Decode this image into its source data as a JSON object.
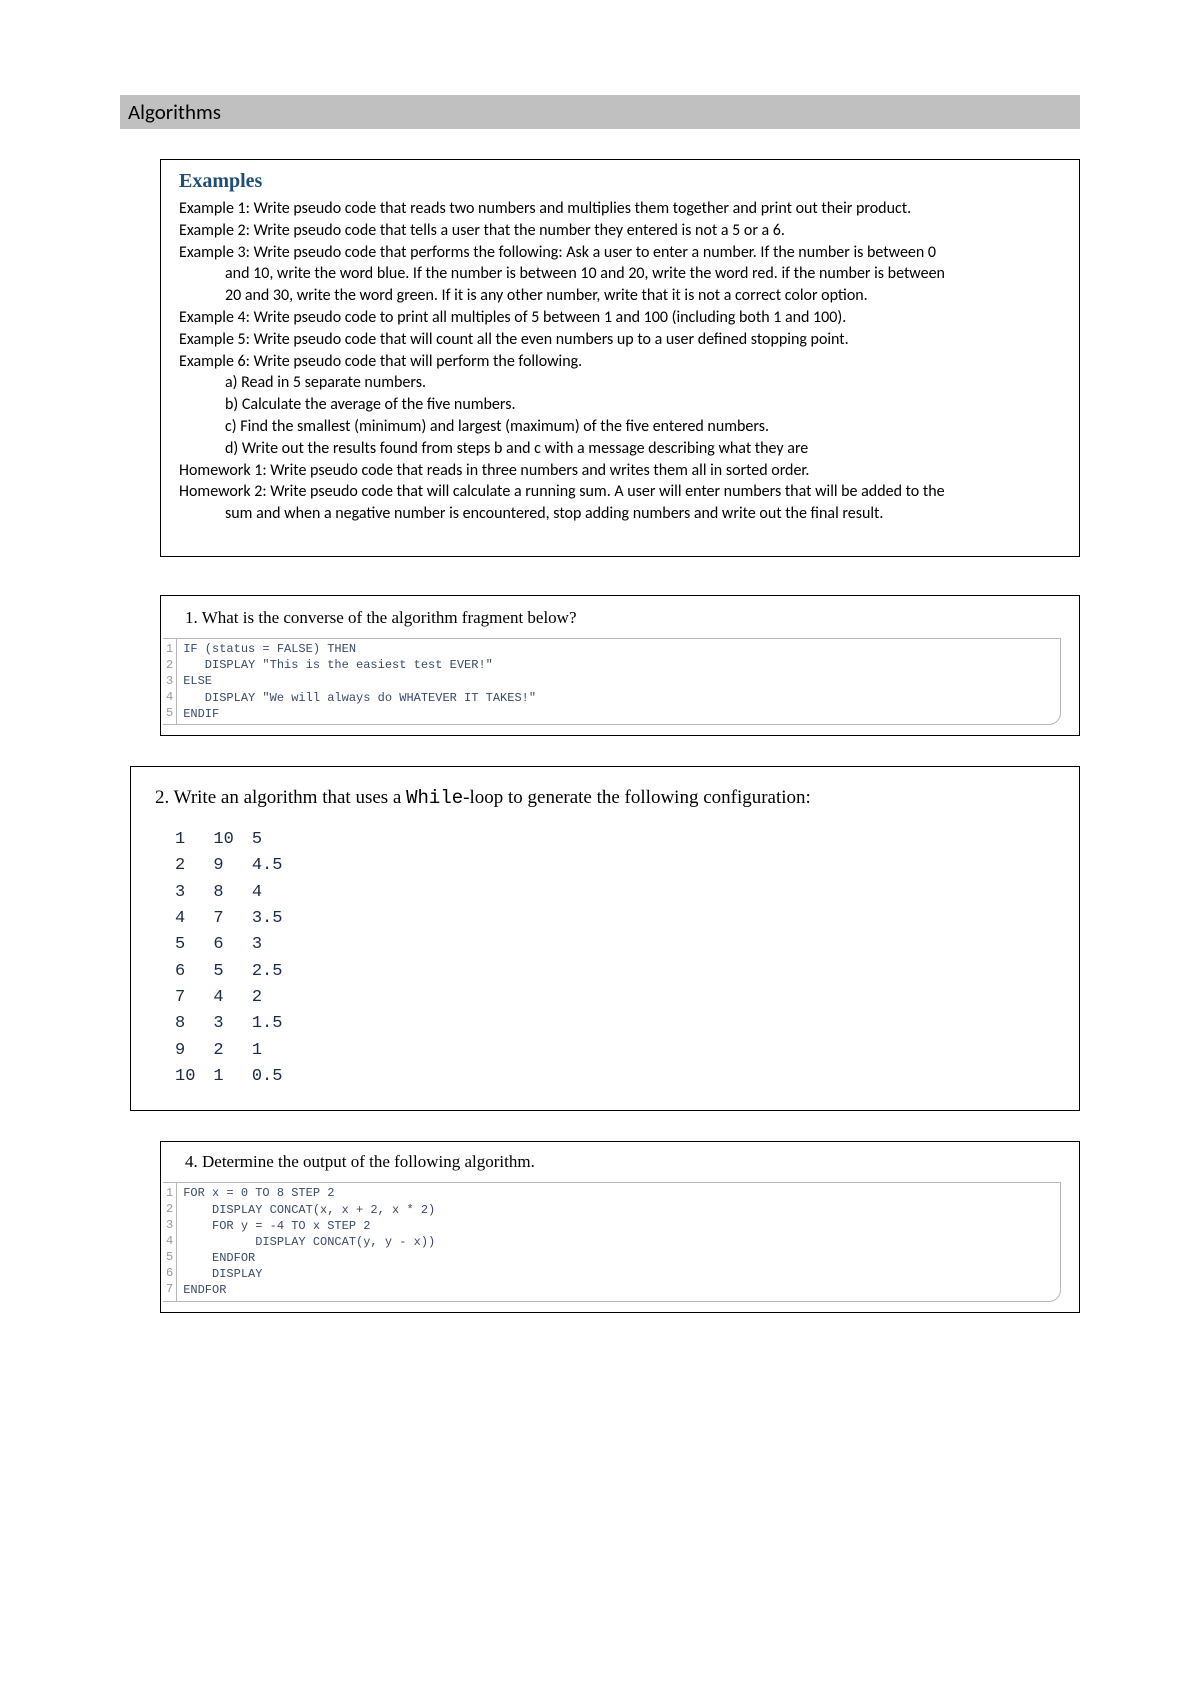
{
  "section_header": "Algorithms",
  "examples": {
    "title": "Examples",
    "lines": [
      "Example 1: Write pseudo code that reads two numbers and multiplies them together and print out their product.",
      "Example 2: Write pseudo code that tells a user that the number they entered is not a 5 or a 6.",
      "Example 3: Write pseudo code that performs the following: Ask a user to enter a number. If the number is between 0",
      "and 10, write the word blue. If the number is between 10 and 20, write the word red. if the number is between",
      "20 and 30, write the word green. If it is any other number, write that it is not a correct color option.",
      "Example 4: Write pseudo code to print all multiples of 5 between 1 and 100 (including both 1 and 100).",
      "Example 5: Write pseudo code that will count all the even numbers up to a user defined stopping point.",
      "Example 6: Write pseudo code that will perform the following.",
      "a) Read in 5 separate numbers.",
      "b) Calculate the average of the five numbers.",
      "c) Find the smallest (minimum) and largest (maximum) of the five entered numbers.",
      "d) Write out the results found from steps b and c with a message describing what they are",
      "Homework 1: Write pseudo code that reads in three numbers and writes them all in sorted order.",
      "Homework 2: Write pseudo code that will calculate a running sum. A user will enter numbers that will be added to the",
      "sum and when a negative number is encountered, stop adding numbers and write out the final result."
    ]
  },
  "q1": {
    "prompt": "1. What is the converse of the algorithm fragment below?",
    "code": [
      "IF (status = FALSE) THEN",
      "   DISPLAY \"This is the easiest test EVER!\"",
      "ELSE",
      "   DISPLAY \"We will always do WHATEVER IT TAKES!\"",
      "ENDIF"
    ]
  },
  "q2": {
    "prompt_prefix": "2. Write an algorithm that uses a ",
    "prompt_mono": "While",
    "prompt_suffix": "-loop to generate the following configuration:",
    "rows": [
      [
        "1",
        "10",
        "5"
      ],
      [
        "2",
        "9",
        "4.5"
      ],
      [
        "3",
        "8",
        "4"
      ],
      [
        "4",
        "7",
        "3.5"
      ],
      [
        "5",
        "6",
        "3"
      ],
      [
        "6",
        "5",
        "2.5"
      ],
      [
        "7",
        "4",
        "2"
      ],
      [
        "8",
        "3",
        "1.5"
      ],
      [
        "9",
        "2",
        "1"
      ],
      [
        "10",
        "1",
        "0.5"
      ]
    ]
  },
  "q4": {
    "prompt": "4. Determine the output of the following algorithm.",
    "code": [
      "FOR x = 0 TO 8 STEP 2",
      "    DISPLAY CONCAT(x, x + 2, x * 2)",
      "    FOR y = -4 TO x STEP 2",
      "          DISPLAY CONCAT(y, y - x))",
      "    ENDFOR",
      "    DISPLAY",
      "ENDFOR"
    ]
  }
}
